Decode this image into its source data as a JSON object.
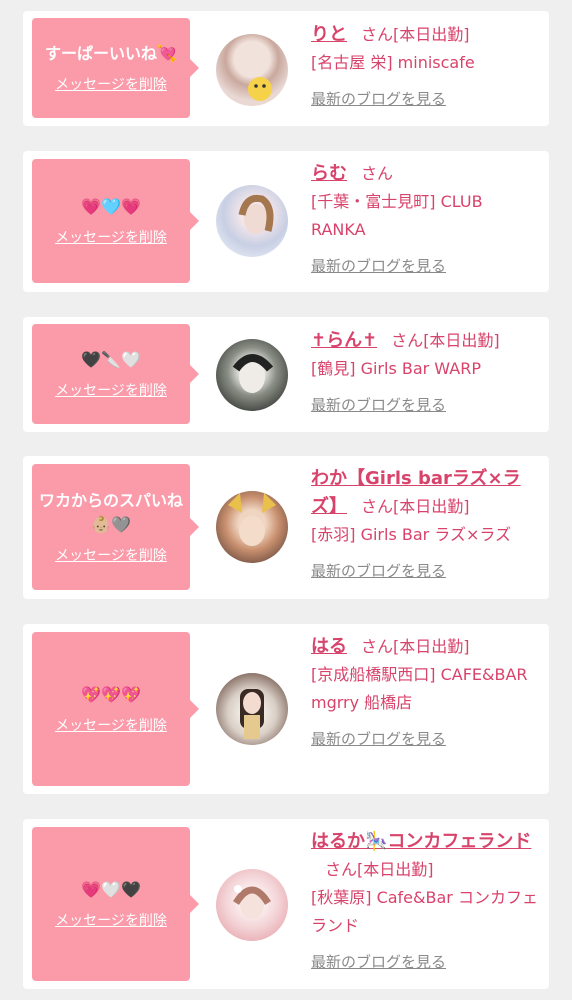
{
  "cards": [
    {
      "message": "すーぱーいいね💘",
      "delete_label": "メッセージを削除",
      "name": "りと",
      "honorific": "さん",
      "status": "[本日出勤]",
      "shop": "[名古屋 栄] miniscafe",
      "blog_link": "最新のブログを見る",
      "avatar_colors": [
        "#e9d8d4",
        "#c9a89d",
        "#f4e1a0"
      ]
    },
    {
      "message": "💗🩵💗",
      "delete_label": "メッセージを削除",
      "name": "らむ",
      "honorific": "さん",
      "status": "",
      "shop": "[千葉・富士見町] CLUB RANKA",
      "blog_link": "最新のブログを見る",
      "avatar_colors": [
        "#dfe6f1",
        "#c8cfe4",
        "#eef1f8"
      ]
    },
    {
      "message": "🖤🔪🤍",
      "delete_label": "メッセージを削除",
      "name": "✝らん✝",
      "honorific": "さん",
      "status": "[本日出勤]",
      "shop": "[鶴見] Girls Bar WARP",
      "blog_link": "最新のブログを見る",
      "avatar_colors": [
        "#8a8f86",
        "#3d403b",
        "#d6d6d0"
      ]
    },
    {
      "message": "ワカからのスパいね👶🏼🩶",
      "delete_label": "メッセージを削除",
      "name": "わか【Girls barラズ×ラズ】",
      "honorific": "さん",
      "status": "[本日出勤]",
      "shop": "[赤羽] Girls Bar ラズ×ラズ",
      "blog_link": "最新のブログを見る",
      "avatar_colors": [
        "#6b4b3e",
        "#c88f6e",
        "#e6c3a4"
      ]
    },
    {
      "message": "💖💖💖",
      "delete_label": "メッセージを削除",
      "name": "はる",
      "honorific": "さん",
      "status": "[本日出勤]",
      "shop": "[京成船橋駅西口] CAFE&BAR mgrry 船橋店",
      "blog_link": "最新のブログを見る",
      "avatar_colors": [
        "#d9cfc6",
        "#6e5248",
        "#f1ece6"
      ]
    },
    {
      "message": "💗🤍🖤",
      "delete_label": "メッセージを削除",
      "name": "はるか🎠コンカフェランド",
      "honorific": "さん",
      "status": "[本日出勤]",
      "shop": "[秋葉原] Cafe&Bar コンカフェランド",
      "blog_link": "最新のブログを見る",
      "avatar_colors": [
        "#f3d3d6",
        "#e7a6ad",
        "#fbeff0"
      ]
    }
  ]
}
